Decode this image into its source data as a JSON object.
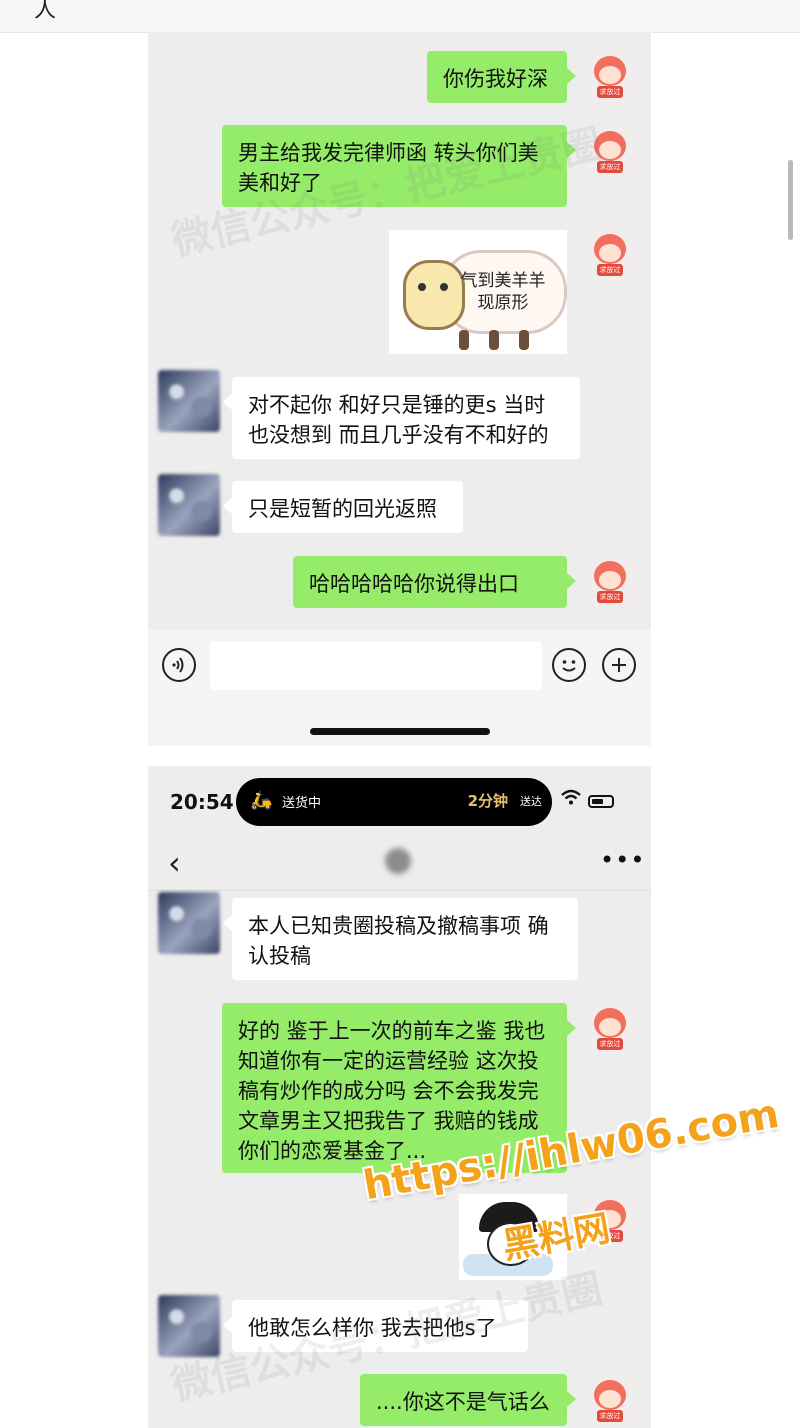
{
  "top_bar": {
    "stub_glyph": "人"
  },
  "stamp_text": "求放过",
  "screenshot1": {
    "messages": [
      {
        "sender": "me",
        "text": "你伤我好深"
      },
      {
        "sender": "me",
        "text": "男主给我发完律师函 转头你们美美和好了"
      },
      {
        "sender": "me",
        "type": "sticker",
        "text": "气到美羊羊现原形"
      },
      {
        "sender": "other",
        "text": "对不起你 和好只是锤的更s 当时也没想到 而且几乎没有不和好的"
      },
      {
        "sender": "other",
        "text": "只是短暂的回光返照"
      },
      {
        "sender": "me",
        "text": "哈哈哈哈哈你说得出口"
      }
    ],
    "input_bar": {
      "voice_icon": "voice-icon",
      "emoji_icon": "emoji-icon",
      "plus_icon": "plus-icon",
      "input_value": ""
    }
  },
  "screenshot2": {
    "status_bar": {
      "time": "20:54",
      "delivery_text": "送货中",
      "eta": "2分钟",
      "eta_suffix": "送达"
    },
    "nav": {
      "back_glyph": "‹",
      "more_glyph": "•••"
    },
    "messages": [
      {
        "sender": "other",
        "text": "本人已知贵圈投稿及撤稿事项 确认投稿"
      },
      {
        "sender": "me",
        "text": "好的 鉴于上一次的前车之鉴 我也知道你有一定的运营经验 这次投稿有炒作的成分吗 会不会我发完文章男主又把我告了 我赔的钱成你们的恋爱基金了..."
      },
      {
        "sender": "me",
        "type": "sticker"
      },
      {
        "sender": "other",
        "text": "他敢怎么样你 我去把他s了"
      },
      {
        "sender": "me",
        "text": "....你这不是气话么"
      }
    ]
  },
  "watermark": {
    "text": "微信公众号：把爱上贵圈"
  },
  "overlay": {
    "url": "https://ihlw06.com",
    "brand": "黑料网"
  }
}
